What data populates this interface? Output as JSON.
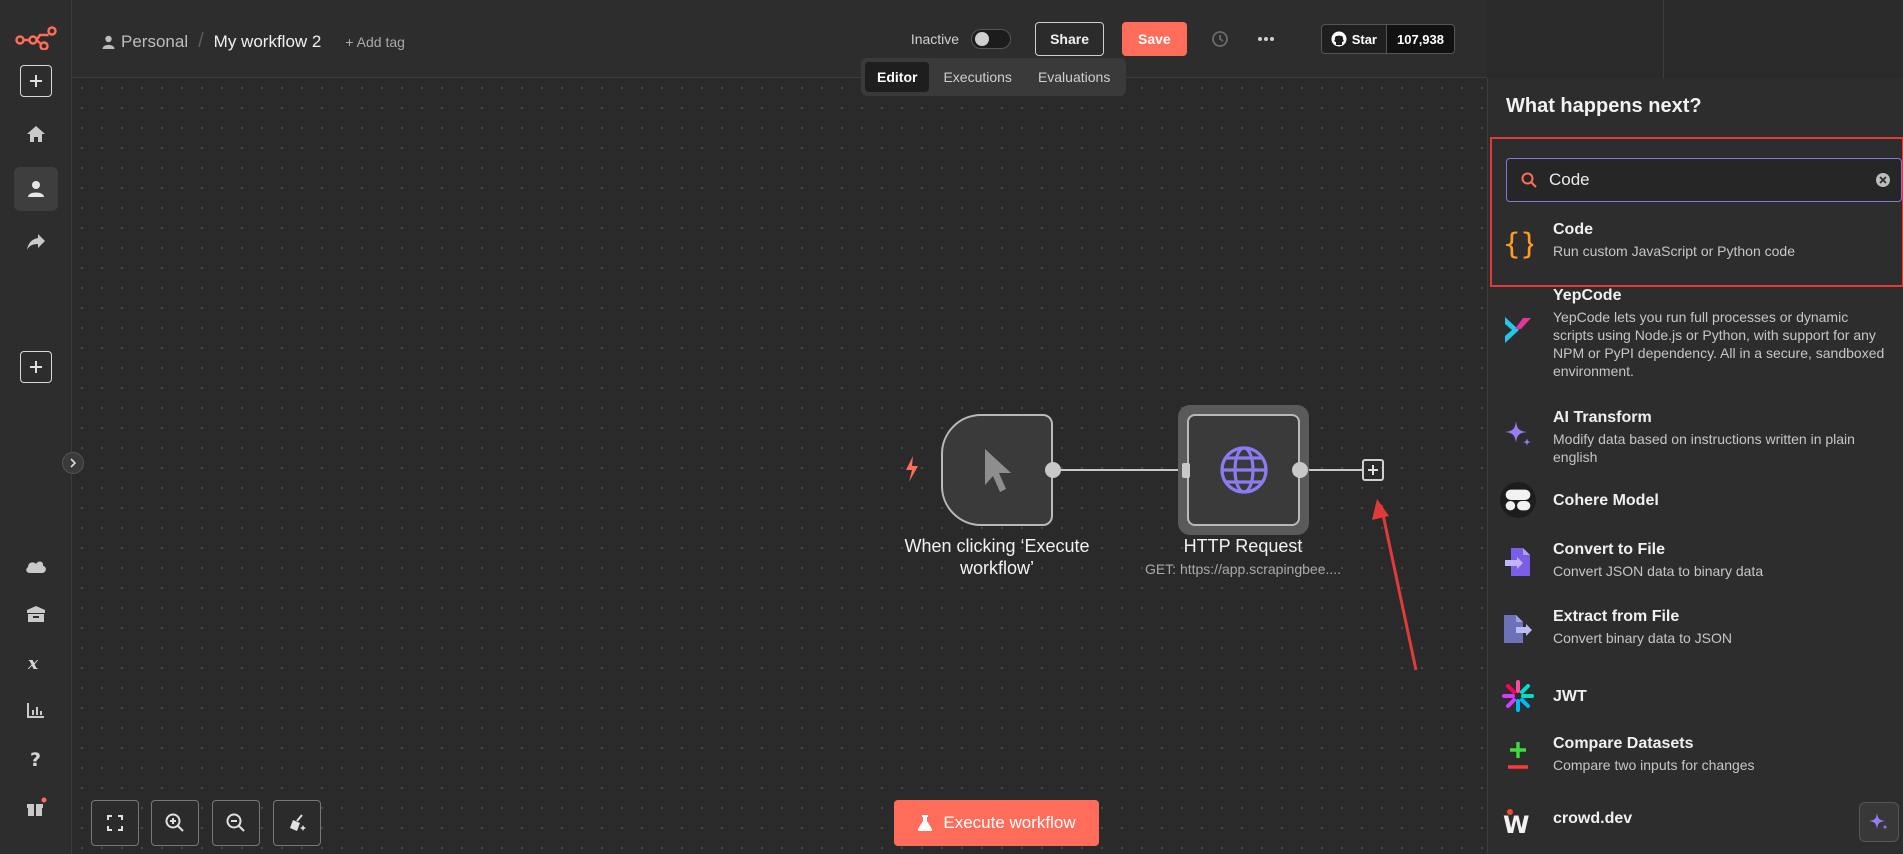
{
  "header": {
    "project": "Personal",
    "separator": "/",
    "workflow_name": "My workflow 2",
    "add_tag": "+ Add tag",
    "status_label": "Inactive",
    "share_label": "Share",
    "save_label": "Save",
    "github_star": "Star",
    "github_count": "107,938"
  },
  "tabs": [
    "Editor",
    "Executions",
    "Evaluations"
  ],
  "nodes": {
    "trigger": {
      "label_line1": "When clicking ‘Execute",
      "label_line2": "workflow’"
    },
    "http": {
      "label": "HTTP Request",
      "subtitle": "GET: https://app.scrapingbee...."
    }
  },
  "canvas": {
    "execute_label": "Execute workflow"
  },
  "panel": {
    "title": "What happens next?",
    "search_value": "Code",
    "results": [
      {
        "title": "Code",
        "desc": "Run custom JavaScript or Python code",
        "icon": "braces-icon"
      },
      {
        "title": "YepCode",
        "desc": "YepCode lets you run full processes or dynamic scripts using Node.js or Python, with support for any NPM or PyPI dependency. All in a secure, sandboxed environment.",
        "icon": "yepcode-icon"
      },
      {
        "title": "AI Transform",
        "desc": "Modify data based on instructions written in plain english",
        "icon": "sparkle-icon"
      },
      {
        "title": "Cohere Model",
        "desc": "",
        "icon": "cohere-icon"
      },
      {
        "title": "Convert to File",
        "desc": "Convert JSON data to binary data",
        "icon": "file-convert-icon"
      },
      {
        "title": "Extract from File",
        "desc": "Convert binary data to JSON",
        "icon": "file-extract-icon"
      },
      {
        "title": "JWT",
        "desc": "",
        "icon": "jwt-icon"
      },
      {
        "title": "Compare Datasets",
        "desc": "Compare two inputs for changes",
        "icon": "compare-icon"
      },
      {
        "title": "crowd.dev",
        "desc": "",
        "icon": "crowddev-icon"
      }
    ]
  },
  "colors": {
    "accent": "#ff6d5a",
    "highlight": "#e03a3a",
    "search_border": "#8a73d7"
  }
}
